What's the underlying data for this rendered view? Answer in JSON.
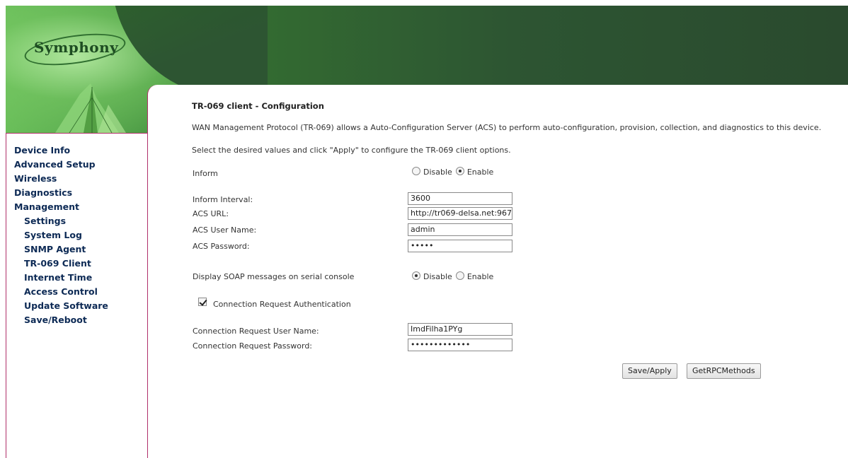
{
  "brand": {
    "logo_text": "Symphony"
  },
  "sidebar": {
    "items": [
      {
        "label": "Device Info",
        "level": "top"
      },
      {
        "label": "Advanced Setup",
        "level": "top"
      },
      {
        "label": "Wireless",
        "level": "top"
      },
      {
        "label": "Diagnostics",
        "level": "top"
      },
      {
        "label": "Management",
        "level": "top"
      },
      {
        "label": "Settings",
        "level": "sub"
      },
      {
        "label": "System Log",
        "level": "sub"
      },
      {
        "label": "SNMP Agent",
        "level": "sub"
      },
      {
        "label": "TR-069 Client",
        "level": "sub"
      },
      {
        "label": "Internet Time",
        "level": "sub"
      },
      {
        "label": "Access Control",
        "level": "sub"
      },
      {
        "label": "Update Software",
        "level": "sub"
      },
      {
        "label": "Save/Reboot",
        "level": "sub"
      }
    ]
  },
  "main": {
    "title": "TR-069 client - Configuration",
    "description": "WAN Management Protocol (TR-069) allows a Auto-Configuration Server (ACS) to perform auto-configuration, provision, collection, and diagnostics to this device.",
    "instruction": "Select the desired values and click \"Apply\" to configure the TR-069 client options.",
    "inform": {
      "label": "Inform",
      "option_disable": "Disable",
      "option_enable": "Enable",
      "selected": "Enable"
    },
    "inform_interval": {
      "label": "Inform Interval:",
      "value": "3600"
    },
    "acs_url": {
      "label": "ACS URL:",
      "value": "http://tr069-delsa.net:967"
    },
    "acs_user": {
      "label": "ACS User Name:",
      "value": "admin"
    },
    "acs_password": {
      "label": "ACS Password:",
      "value": "•••••"
    },
    "soap": {
      "label": "Display SOAP messages on serial console",
      "option_disable": "Disable",
      "option_enable": "Enable",
      "selected": "Disable"
    },
    "conn_auth": {
      "label": "Connection Request Authentication",
      "checked": true
    },
    "conn_user": {
      "label": "Connection Request User Name:",
      "value": "ImdFilha1PYg"
    },
    "conn_password": {
      "label": "Connection Request Password:",
      "value": "•••••••••••••"
    },
    "buttons": {
      "save": "Save/Apply",
      "getrpc": "GetRPCMethods"
    }
  },
  "colors": {
    "sidebar_text": "#0d2a55",
    "border_accent": "#b0306a",
    "banner_dark": "#2d5532",
    "banner_light": "#6abf5a"
  }
}
